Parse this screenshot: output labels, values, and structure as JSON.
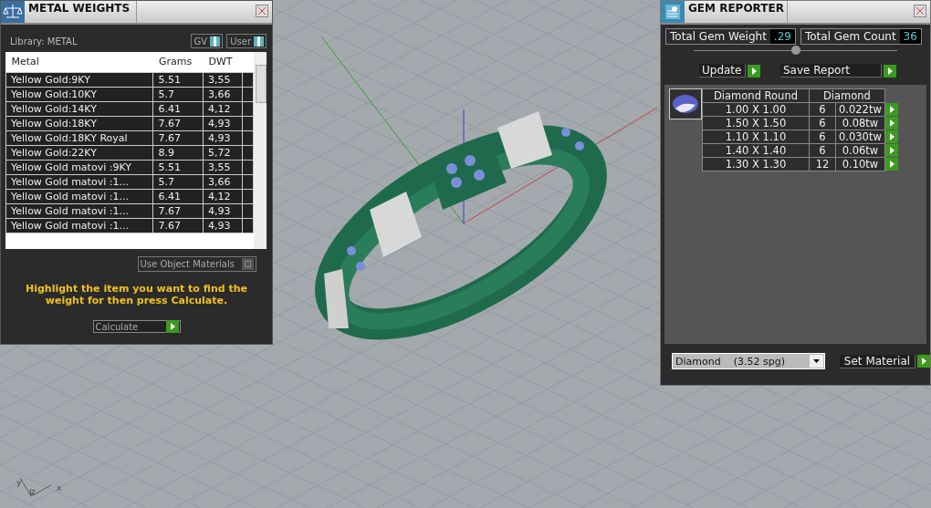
{
  "viewport": {
    "axes": [
      "y",
      "z",
      "x"
    ]
  },
  "metal_weights": {
    "title": "METAL WEIGHTS",
    "library": "Library: METAL",
    "toggles": [
      {
        "label": "GV",
        "on": true
      },
      {
        "label": "User",
        "on": true
      }
    ],
    "table": {
      "columns": [
        "Metal",
        "Grams",
        "DWT"
      ],
      "rows": [
        {
          "cells": [
            "Yellow Gold:9KY",
            "5.51",
            "3,55"
          ]
        },
        {
          "cells": [
            "Yellow Gold:10KY",
            "5.7",
            "3,66"
          ]
        },
        {
          "cells": [
            "Yellow Gold:14KY",
            "6.41",
            "4,12"
          ]
        },
        {
          "cells": [
            "Yellow Gold:18KY",
            "7.67",
            "4,93"
          ]
        },
        {
          "cells": [
            "Yellow Gold:18KY Royal",
            "7.67",
            "4,93"
          ]
        },
        {
          "cells": [
            "Yellow Gold:22KY",
            "8.9",
            "5,72"
          ]
        },
        {
          "cells": [
            "Yellow Gold matovi :9KY",
            "5.51",
            "3,55"
          ]
        },
        {
          "cells": [
            "Yellow Gold matovi :1...",
            "5.7",
            "3,66"
          ]
        },
        {
          "cells": [
            "Yellow Gold matovi :1...",
            "6.41",
            "4,12"
          ]
        },
        {
          "cells": [
            "Yellow Gold matovi :1...",
            "7.67",
            "4,93"
          ]
        },
        {
          "cells": [
            "Yellow Gold matovi :1...",
            "7.67",
            "4,93"
          ]
        }
      ]
    },
    "use_object_materials": {
      "label": "Use Object Materials",
      "on": false
    },
    "hint": "Highlight the item you want to find the weight for then press Calculate.",
    "calculate": "Calculate"
  },
  "gem_reporter": {
    "title": "GEM REPORTER",
    "stats": [
      {
        "label": "Total Gem Weight",
        "value": ".29"
      },
      {
        "label": "Total Gem Count",
        "value": "36"
      }
    ],
    "buttons": [
      "Update",
      "Save Report"
    ],
    "table": {
      "columns": [
        "Diamond Round",
        "Diamond"
      ],
      "rows": [
        {
          "size": "1.00 X 1.00",
          "count": "6",
          "weight": "0.022tw"
        },
        {
          "size": "1.50 X 1.50",
          "count": "6",
          "weight": "0.08tw"
        },
        {
          "size": "1.10 X 1.10",
          "count": "6",
          "weight": "0.030tw"
        },
        {
          "size": "1.40 X 1.40",
          "count": "6",
          "weight": "0.06tw"
        },
        {
          "size": "1.30 X 1.30",
          "count": "12",
          "weight": "0.10tw"
        }
      ]
    },
    "material": {
      "value": "Diamond    (3.52 spg)"
    },
    "set_button": "Set Material"
  }
}
